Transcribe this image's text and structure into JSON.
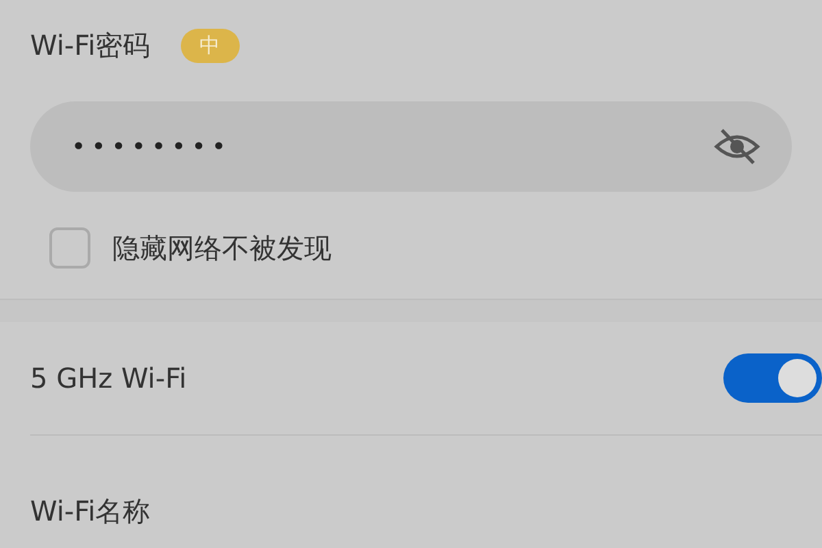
{
  "password": {
    "label": "Wi-Fi密码",
    "strength": "中",
    "value": "••••••••",
    "visible": false
  },
  "hide_network": {
    "label": "隐藏网络不被发现",
    "checked": false
  },
  "band_5ghz": {
    "label": "5 GHz Wi-Fi",
    "on": true
  },
  "next_row": {
    "label": "Wi-Fi名称"
  }
}
